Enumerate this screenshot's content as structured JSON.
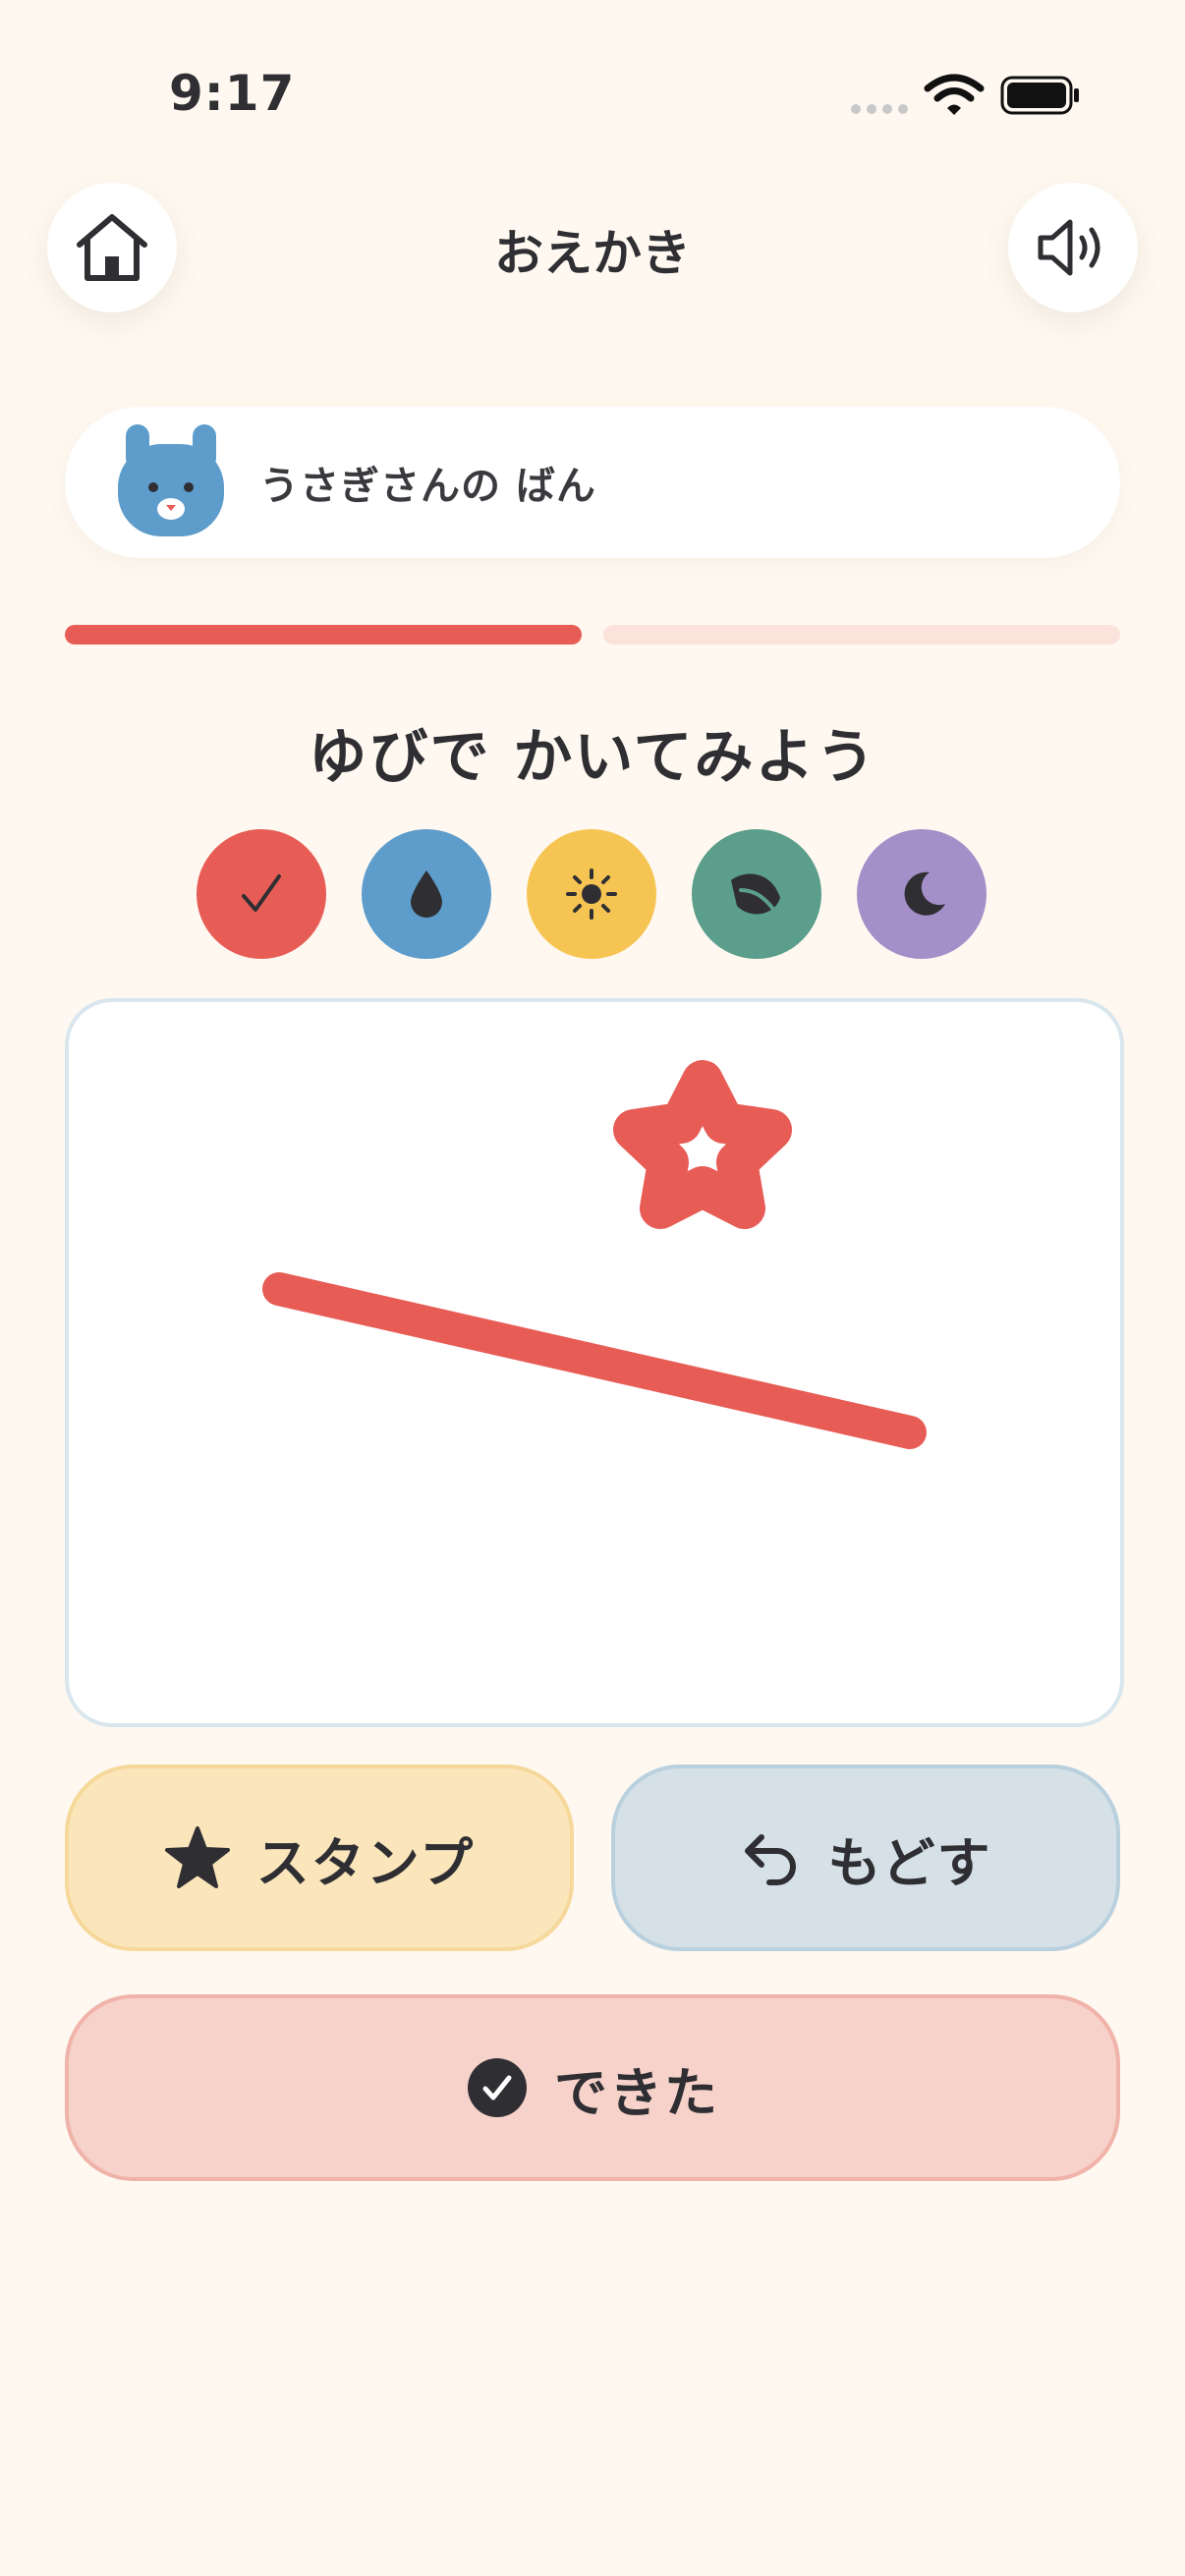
{
  "status_bar": {
    "time": "9:17"
  },
  "header": {
    "title": "おえかき",
    "home_icon": "home-icon",
    "sound_icon": "speaker-icon"
  },
  "player": {
    "label": "うさぎさんの ばん",
    "avatar_icon": "bunny-avatar-icon"
  },
  "progress": {
    "current": 1,
    "total": 2,
    "active_color": "#E85C56",
    "inactive_color": "#FBE3DC"
  },
  "prompt": "ゆびで かいてみよう",
  "colors": [
    {
      "name": "red",
      "hex": "#E85C56",
      "icon": "check-icon",
      "selected": true
    },
    {
      "name": "blue",
      "hex": "#5E9CCB",
      "icon": "drop-icon",
      "selected": false
    },
    {
      "name": "yellow",
      "hex": "#F6C452",
      "icon": "sun-icon",
      "selected": false
    },
    {
      "name": "green",
      "hex": "#5A9E8B",
      "icon": "leaf-icon",
      "selected": false
    },
    {
      "name": "purple",
      "hex": "#A58FC9",
      "icon": "moon-icon",
      "selected": false
    }
  ],
  "canvas": {
    "stroke_color": "#E85C56",
    "contents": [
      "star-stamp",
      "line-stroke"
    ]
  },
  "actions": {
    "stamp_label": "スタンプ",
    "undo_label": "もどす",
    "done_label": "できた"
  }
}
